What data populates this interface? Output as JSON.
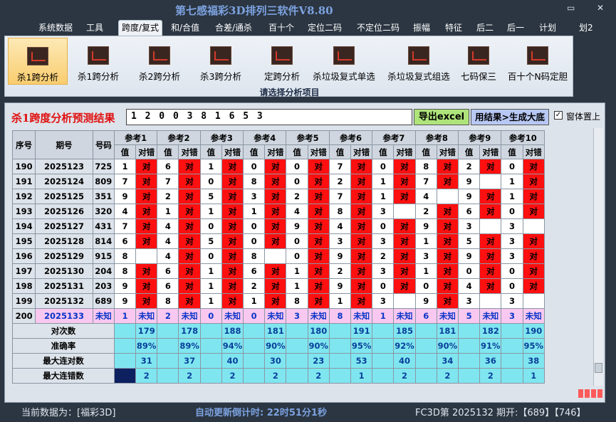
{
  "app": {
    "title": "第七感福彩3D排列三软件V8.80"
  },
  "menu": [
    "系统数据",
    "工具",
    "跨度/复式",
    "和/合值",
    "合差/通杀",
    "百十个",
    "定位二码",
    "不定位二码",
    "振幅",
    "特征",
    "后二",
    "后一",
    "计划",
    "划2"
  ],
  "ribbon": {
    "buttons": [
      "杀1跨分析",
      "杀1跨分析",
      "杀2跨分析",
      "杀3跨分析",
      "定跨分析",
      "杀垃圾复式单选",
      "杀垃圾复式组选",
      "七码保三",
      "百十个N码定胆"
    ],
    "caption": "请选择分析项目"
  },
  "result": {
    "label": "杀1跨度分析预测结果",
    "value": "1 2 0 0 3 8 1 6 5 3",
    "export_label": "导出excel",
    "generate_label": "用结果>生成大底",
    "pin_label": "窗体置上"
  },
  "table": {
    "headers": {
      "seq": "序号",
      "period": "期号",
      "number": "号码",
      "ref_prefix": "参考",
      "val": "值",
      "dc": "对错"
    },
    "refs": [
      "参考1",
      "参考2",
      "参考3",
      "参考4",
      "参考5",
      "参考6",
      "参考7",
      "参考8",
      "参考9",
      "参考10"
    ],
    "rows": [
      {
        "seq": "190",
        "period": "2025123",
        "num": "725",
        "vals": [
          "1",
          "6",
          "1",
          "0",
          "0",
          "7",
          "0",
          "8",
          "2",
          "0"
        ],
        "dc": [
          "对",
          "对",
          "对",
          "对",
          "对",
          "对",
          "对",
          "对",
          "对",
          "对"
        ]
      },
      {
        "seq": "191",
        "period": "2025124",
        "num": "809",
        "vals": [
          "7",
          "7",
          "0",
          "8",
          "0",
          "2",
          "1",
          "7",
          "9",
          "1"
        ],
        "dc": [
          "对",
          "对",
          "对",
          "对",
          "对",
          "对",
          "对",
          "对",
          "",
          "对"
        ]
      },
      {
        "seq": "192",
        "period": "2025125",
        "num": "351",
        "vals": [
          "9",
          "2",
          "5",
          "3",
          "2",
          "7",
          "1",
          "4",
          "9",
          "1"
        ],
        "dc": [
          "对",
          "对",
          "对",
          "对",
          "对",
          "对",
          "对",
          "",
          "对",
          "对"
        ]
      },
      {
        "seq": "193",
        "period": "2025126",
        "num": "320",
        "vals": [
          "4",
          "1",
          "1",
          "1",
          "4",
          "8",
          "3",
          "2",
          "6",
          "0"
        ],
        "dc": [
          "对",
          "对",
          "对",
          "对",
          "对",
          "对",
          "",
          "对",
          "对",
          "对"
        ]
      },
      {
        "seq": "194",
        "period": "2025127",
        "num": "431",
        "vals": [
          "7",
          "4",
          "0",
          "0",
          "9",
          "4",
          "0",
          "9",
          "3",
          "3"
        ],
        "dc": [
          "对",
          "对",
          "对",
          "对",
          "对",
          "对",
          "对",
          "对",
          "",
          ""
        ]
      },
      {
        "seq": "195",
        "period": "2025128",
        "num": "814",
        "vals": [
          "6",
          "4",
          "5",
          "0",
          "0",
          "3",
          "3",
          "1",
          "5",
          "3"
        ],
        "dc": [
          "对",
          "对",
          "对",
          "对",
          "对",
          "对",
          "对",
          "对",
          "对",
          "对"
        ]
      },
      {
        "seq": "196",
        "period": "2025129",
        "num": "915",
        "vals": [
          "8",
          "4",
          "0",
          "8",
          "0",
          "9",
          "2",
          "3",
          "9",
          "3"
        ],
        "dc": [
          "",
          "对",
          "对",
          "",
          "对",
          "对",
          "对",
          "对",
          "对",
          "对"
        ]
      },
      {
        "seq": "197",
        "period": "2025130",
        "num": "204",
        "vals": [
          "8",
          "6",
          "1",
          "6",
          "1",
          "2",
          "3",
          "1",
          "0",
          "0"
        ],
        "dc": [
          "对",
          "对",
          "对",
          "对",
          "对",
          "对",
          "对",
          "对",
          "对",
          "对"
        ]
      },
      {
        "seq": "198",
        "period": "2025131",
        "num": "203",
        "vals": [
          "9",
          "6",
          "1",
          "2",
          "1",
          "9",
          "0",
          "0",
          "4",
          "0"
        ],
        "dc": [
          "对",
          "对",
          "对",
          "对",
          "对",
          "对",
          "对",
          "对",
          "对",
          "对"
        ]
      },
      {
        "seq": "199",
        "period": "2025132",
        "num": "689",
        "vals": [
          "9",
          "8",
          "1",
          "1",
          "8",
          "1",
          "3",
          "9",
          "3",
          "3"
        ],
        "dc": [
          "对",
          "对",
          "对",
          "对",
          "对",
          "对",
          "",
          "对",
          "",
          ""
        ]
      }
    ],
    "miss_marks": [
      [],
      [
        8
      ],
      [
        7
      ],
      [
        6
      ],
      [
        8,
        9
      ],
      [],
      [
        0,
        3
      ],
      [],
      [],
      [
        6,
        8,
        9
      ]
    ],
    "unknown": {
      "seq": "200",
      "period": "2025133",
      "num": "未知",
      "vals": [
        "1",
        "2",
        "0",
        "0",
        "3",
        "8",
        "1",
        "6",
        "5",
        "3"
      ],
      "dc_label": "未知"
    },
    "stats": [
      {
        "label": "对次数",
        "vals": [
          "179",
          "178",
          "188",
          "181",
          "180",
          "191",
          "185",
          "181",
          "182",
          "190"
        ]
      },
      {
        "label": "准确率",
        "vals": [
          "89%",
          "89%",
          "94%",
          "90%",
          "90%",
          "95%",
          "92%",
          "90%",
          "91%",
          "95%"
        ]
      },
      {
        "label": "最大连对数",
        "vals": [
          "31",
          "37",
          "40",
          "30",
          "23",
          "53",
          "40",
          "34",
          "36",
          "38"
        ]
      },
      {
        "label": "最大连错数",
        "vals": [
          "2",
          "2",
          "2",
          "2",
          "2",
          "1",
          "2",
          "2",
          "2",
          "1"
        ]
      }
    ]
  },
  "status": {
    "current": "当前数据为：[福彩3D]",
    "countdown": "自动更新倒计时:  22时51分1秒",
    "last": "FC3D第 2025132 期开:【689】【746】"
  },
  "colors": {
    "hit": "#ff1010",
    "unknown": "#f8c8f0",
    "stat": "#7fe6f0",
    "accent": "#7da2e0"
  }
}
